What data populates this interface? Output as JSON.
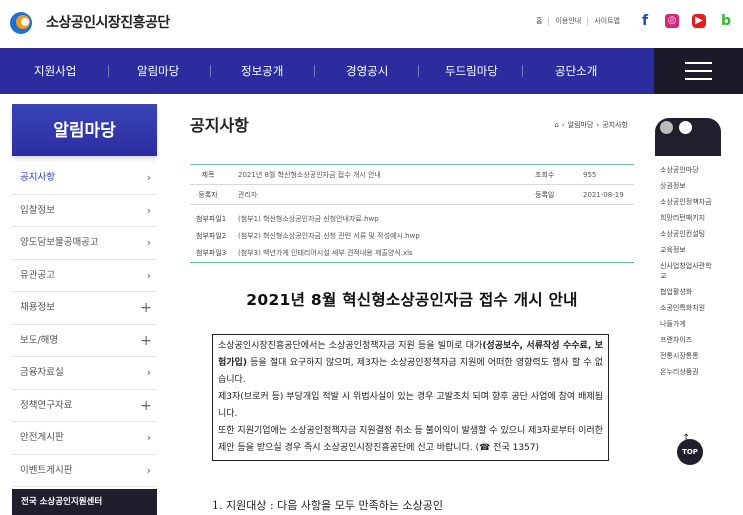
{
  "header": {
    "site_name": "소상공인시장진흥공단",
    "util_links": [
      "홈",
      "이용안내",
      "사이트맵"
    ],
    "sns": [
      {
        "name": "facebook",
        "icon": "facebook-icon",
        "glyph": "f"
      },
      {
        "name": "instagram",
        "icon": "instagram-icon",
        "glyph": "◎"
      },
      {
        "name": "youtube",
        "icon": "youtube-icon",
        "glyph": "▶"
      },
      {
        "name": "blog",
        "icon": "blog-icon",
        "glyph": "b"
      }
    ]
  },
  "gnb": {
    "items": [
      "지원사업",
      "알림마당",
      "정보공개",
      "경영공시",
      "두드림마당",
      "공단소개"
    ],
    "menu_icon": "hamburger-menu-icon",
    "bg_color": "#2b2d9e"
  },
  "lnb": {
    "title": "알림마당",
    "items": [
      {
        "label": "공지사항",
        "type": "arrow",
        "active": true
      },
      {
        "label": "입찰정보",
        "type": "arrow"
      },
      {
        "label": "양도담보물공매공고",
        "type": "arrow"
      },
      {
        "label": "유관공고",
        "type": "arrow"
      },
      {
        "label": "채용정보",
        "type": "plus"
      },
      {
        "label": "보도/해명",
        "type": "plus"
      },
      {
        "label": "금융자료실",
        "type": "arrow"
      },
      {
        "label": "정책연구자료",
        "type": "plus"
      },
      {
        "label": "안전게시판",
        "type": "arrow"
      },
      {
        "label": "이벤트게시판",
        "type": "arrow"
      }
    ],
    "banner": "전국 소상공인지원센터",
    "arrow_glyph": "›",
    "plus_glyph": "+"
  },
  "content": {
    "page_title": "공지사항",
    "breadcrumb": [
      "알림마당",
      "공지사항"
    ],
    "breadcrumb_sep": "›",
    "home_glyph": "⌂"
  },
  "post": {
    "subject_label": "제목",
    "subject": "2021년 8월 혁신형소상공인자금 접수 개시 안내",
    "views_label": "조회수",
    "views": "955",
    "author_label": "등록자",
    "author": "관리자",
    "date_label": "등록일",
    "date": "2021-08-19",
    "files": [
      {
        "label": "첨부파일1",
        "name": "(첨부1) 혁신형소상공인자금 신청안내자료.hwp"
      },
      {
        "label": "첨부파일2",
        "name": "(첨부2) 혁신형소상공인자금 신청 관련 서류 및 작성예시.hwp"
      },
      {
        "label": "첨부파일3",
        "name": "(첨부3) 백년가게 인테리어시설 세부 견적내용 제출양식.xls"
      }
    ],
    "title": "2021년 8월 혁신형소상공인자금 접수 개시 안내",
    "notice_p1_a": "소상공인시장진흥공단에서는 소상공인정책자금 지원 등을 빌미로 대가",
    "notice_p1_b": "(성공보수, 서류작성 수수료, 보험가입)",
    "notice_p1_c": " 등을 절대 요구하지 않으며, 제3자는 소상공인정책자금 지원에 어떠한 영향력도 행사 할 수 없습니다.",
    "notice_p2": "제3자(브로커 등) 부당개입 적발 시 위법사실이 있는 경우 고발조치 되며 향후 공단 사업에 참여 배제됩니다.",
    "notice_p3": "또한 지원기업에는 소상공인정책자금 지원결정 취소 등 불이익이 발생할 수 있으니 제3자로부터 이러한 제안 등을 받으실 경우 즉시 소상공인시장진흥공단에 신고 바랍니다. (☎ 전국 1357)",
    "list_first": "1. 지원대상 : 다음 사항을 모두 만족하는 소상공인"
  },
  "quick_menu": {
    "items": [
      "소상공인마당",
      "상권정보",
      "소상공인정책자금",
      "희망리턴패키지",
      "소상공인컨설팅",
      "교육정보",
      "신사업창업사관학교",
      "협업활성화",
      "소공인특화지원",
      "나들가게",
      "프랜차이즈",
      "전통시장통통",
      "온누리상품권"
    ],
    "top_label": "TOP",
    "top_arrow": "↑"
  }
}
